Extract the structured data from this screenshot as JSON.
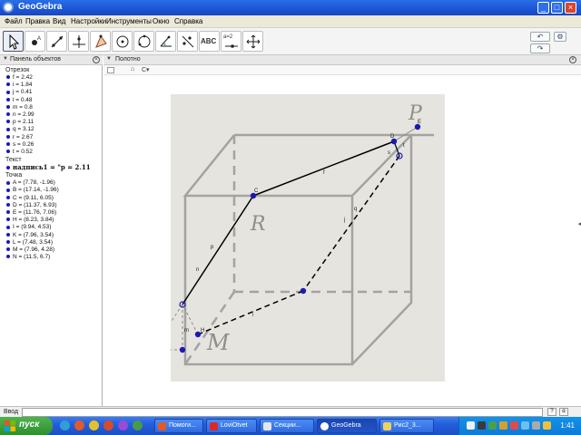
{
  "window": {
    "title": "GeoGebra",
    "buttons": {
      "minimize": "_",
      "maximize": "□",
      "close": "×"
    }
  },
  "menu": [
    "Файл",
    "Правка",
    "Вид",
    "Настройки",
    "Инструменты",
    "Окно",
    "Справка"
  ],
  "toolbar": {
    "text_tool_label": "ABC",
    "slider_tool_label": "a=2",
    "undo": "↶",
    "redo": "↷"
  },
  "object_panel": {
    "title": "Панель объектов",
    "categories": [
      {
        "name": "Отрезок",
        "items": [
          "f = 2.42",
          "i = 1.84",
          "j = 0.41",
          "l = 0.48",
          "m = 0.8",
          "n = 2.99",
          "p = 2.11",
          "q = 3.12",
          "r = 2.67",
          "s = 0.26",
          "t = 0.52"
        ]
      },
      {
        "name": "Текст",
        "items": [
          "надпись1 = \"p  =  2.11"
        ]
      },
      {
        "name": "Точка",
        "items": [
          "A = (7.78, -1.96)",
          "B = (17.14, -1.96)",
          "C = (9.11, 6.05)",
          "D = (11.37, 6.93)",
          "E = (11.76, 7.06)",
          "H = (8.23, 3.84)",
          "I = (9.94, 4.53)",
          "K = (7.96, 3.54)",
          "L = (7.48, 3.54)",
          "M = (7.96, 4.28)",
          "N = (11.5, 6.7)"
        ]
      }
    ]
  },
  "graphics": {
    "title": "Полотно",
    "home": "⌂",
    "view_option": "C▾",
    "figure_labels": {
      "P": "P",
      "R": "R",
      "M": "M",
      "C": "C",
      "D": "D",
      "E": "E",
      "H": "H",
      "f": "f",
      "p": "p",
      "n": "n",
      "q": "q",
      "j": "j",
      "i": "i",
      "m": "m",
      "s": "s",
      "t": "t",
      "l": "l"
    }
  },
  "input_bar": {
    "label": "Ввод",
    "value": ""
  },
  "taskbar": {
    "start": "пуск",
    "tasks": [
      "Помоги...",
      "LoviOtvet",
      "Секции...",
      "GeoGebra",
      "Рис2_3..."
    ],
    "clock": "1:41"
  },
  "colors": {
    "titlebar": "#1c55d4",
    "point": "#1a1ab0",
    "taskbar": "#245edb",
    "start": "#2f8f2f"
  }
}
